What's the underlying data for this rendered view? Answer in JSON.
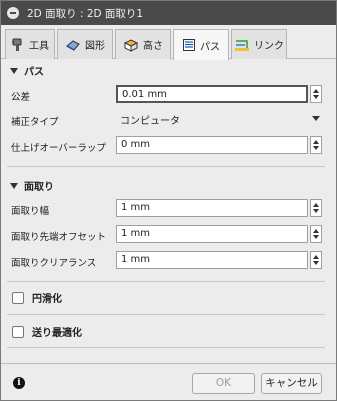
{
  "window": {
    "title": "2D 面取り : 2D 面取り1"
  },
  "tabs": [
    {
      "label": "工具",
      "icon": "tool-icon"
    },
    {
      "label": "図形",
      "icon": "geometry-icon"
    },
    {
      "label": "高さ",
      "icon": "heights-icon"
    },
    {
      "label": "パス",
      "icon": "passes-icon",
      "active": true
    },
    {
      "label": "リンク",
      "icon": "linking-icon"
    }
  ],
  "passes": {
    "header": "パス",
    "tolerance": {
      "label": "公差",
      "value": "0.01 mm"
    },
    "compensation": {
      "label": "補正タイプ",
      "value": "コンピュータ"
    },
    "stock_to_leave": {
      "label": "仕上げオーバーラップ",
      "value": "0 mm"
    }
  },
  "chamfer": {
    "header": "面取り",
    "width": {
      "label": "面取り幅",
      "value": "1 mm"
    },
    "tip_offset": {
      "label": "面取り先端オフセット",
      "value": "1 mm"
    },
    "clearance": {
      "label": "面取りクリアランス",
      "value": "1 mm"
    }
  },
  "smoothing": {
    "label": "円滑化"
  },
  "feed_optimization": {
    "label": "送り最適化"
  },
  "buttons": {
    "ok": "OK",
    "cancel": "キャンセル"
  }
}
